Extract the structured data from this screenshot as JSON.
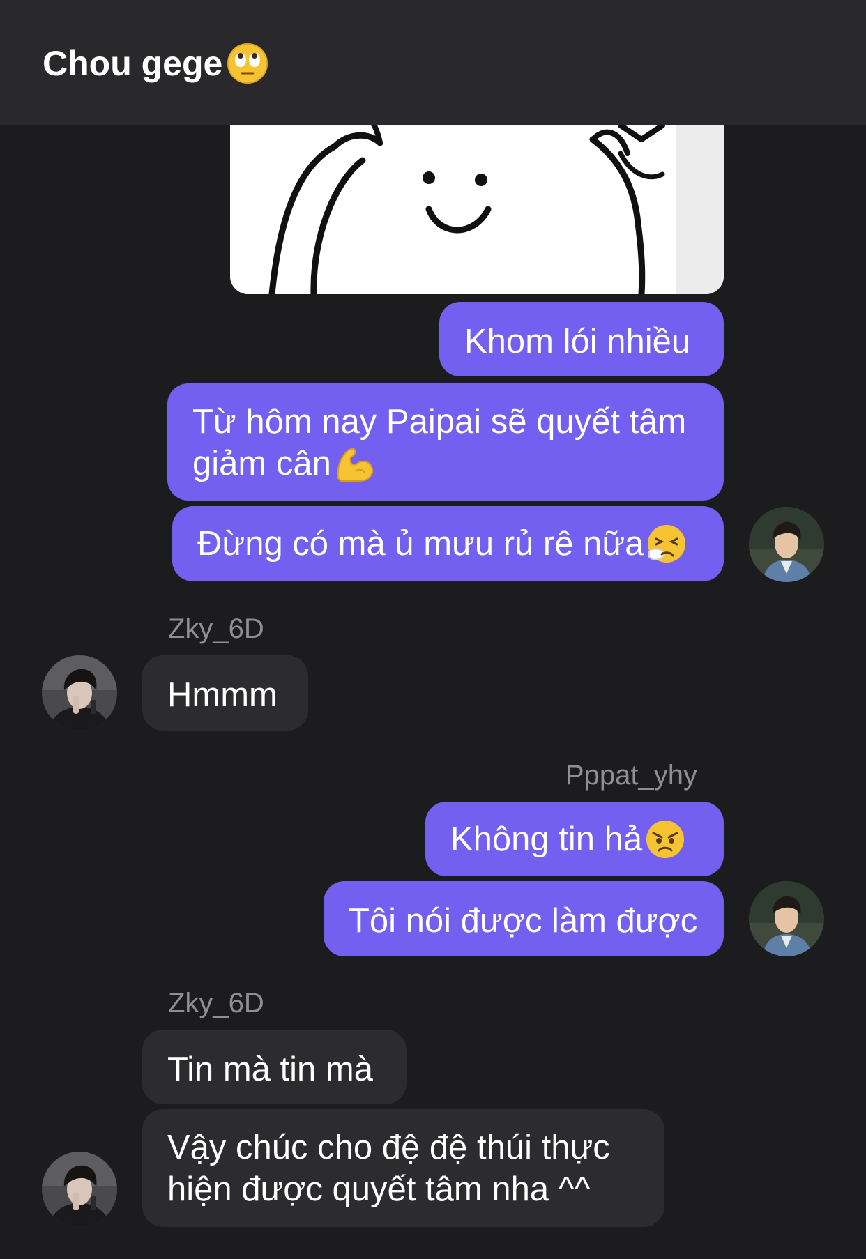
{
  "header": {
    "title": "Chou gege",
    "title_emoji": "face-with-rolling-eyes-icon"
  },
  "chat": {
    "messages": [
      {
        "text": "Khom lói nhiều"
      },
      {
        "text": "Từ hôm nay Paipai sẽ quyết tâm",
        "text2": "giảm cân",
        "emoji": "flexed-biceps-icon"
      },
      {
        "text": "Đừng có mà ủ mưu rủ rê nữa",
        "emoji": "sneezing-face-icon"
      },
      {
        "sender": "Zky_6D",
        "text": "Hmmm"
      },
      {
        "sender": "Pppat_yhy",
        "text": "Không tin hả",
        "emoji": "angry-face-icon"
      },
      {
        "text": "Tôi nói được làm được"
      },
      {
        "sender": "Zky_6D",
        "text": "Tin mà tin mà"
      },
      {
        "text": "Vậy chúc cho đệ đệ thúi thực",
        "text2": "hiện được quyết tâm nha ^^"
      }
    ]
  },
  "colors": {
    "background": "#1c1c1e",
    "header": "#29292b",
    "outgoing_bubble": "#7460f0",
    "incoming_bubble": "#2c2c2e",
    "sender_name": "#8e8e93"
  }
}
